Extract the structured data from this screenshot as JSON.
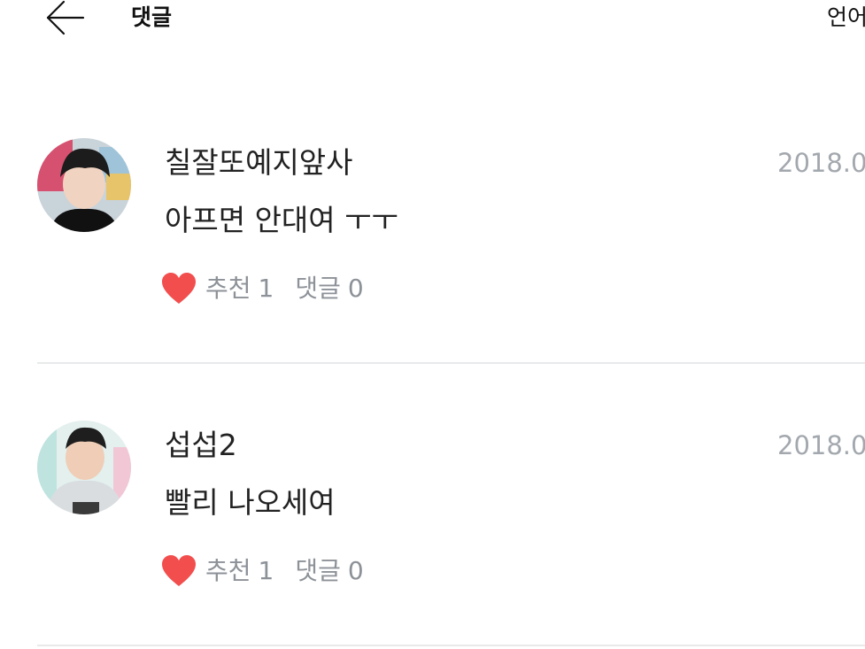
{
  "header": {
    "back_icon": "arrow-left-icon",
    "title": "댓글",
    "language_label": "언어"
  },
  "comments": [
    {
      "author": "칠잘또예지앞사",
      "date": "2018.0",
      "text": "아프면 안대여 ㅜㅜ",
      "like_label": "추천",
      "like_count": "1",
      "reply_label": "댓글",
      "reply_count": "0"
    },
    {
      "author": "섭섭2",
      "date": "2018.0",
      "text": "빨리 나오세여",
      "like_label": "추천",
      "like_count": "1",
      "reply_label": "댓글",
      "reply_count": "0"
    }
  ],
  "colors": {
    "heart": "#f24e4e",
    "meta_gray": "#8d9298",
    "date_gray": "#a3a8ae",
    "divider": "#e8e9eb"
  }
}
